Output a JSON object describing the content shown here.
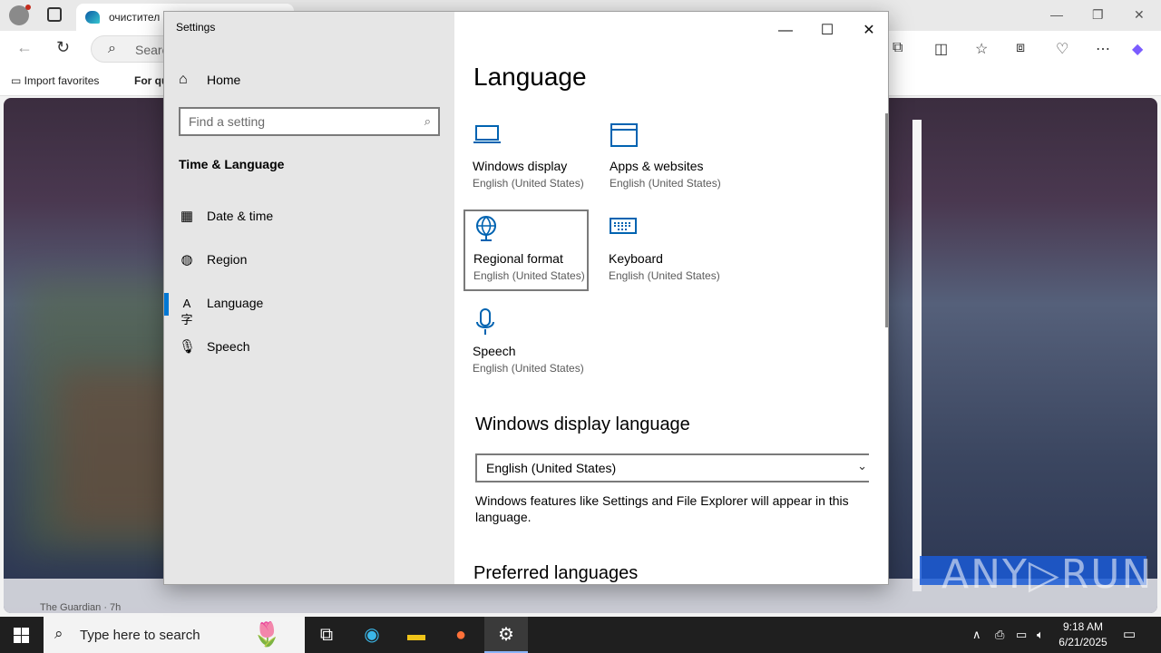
{
  "browser": {
    "tab_title": "очистител",
    "address_placeholder": "Searc",
    "favorites": [
      "Import favorites",
      "For qu"
    ],
    "news_source": "The Guardian · 7h",
    "watermark": "ANY▷RUN"
  },
  "settings": {
    "window_title": "Settings",
    "home_label": "Home",
    "search_placeholder": "Find a setting",
    "section_title": "Time & Language",
    "nav": [
      {
        "label": "Date & time",
        "icon": "calendar-clock-icon"
      },
      {
        "label": "Region",
        "icon": "globe-icon"
      },
      {
        "label": "Language",
        "icon": "language-icon",
        "active": true
      },
      {
        "label": "Speech",
        "icon": "microphone-icon"
      }
    ],
    "page_title": "Language",
    "tiles": [
      {
        "name": "Windows display",
        "sub": "English (United States)",
        "icon": "laptop-icon"
      },
      {
        "name": "Apps & websites",
        "sub": "English (United States)",
        "icon": "window-icon"
      },
      {
        "name": "Regional format",
        "sub": "English (United States)",
        "icon": "regional-globe-icon",
        "selected": true
      },
      {
        "name": "Keyboard",
        "sub": "English (United States)",
        "icon": "keyboard-icon"
      },
      {
        "name": "Speech",
        "sub": "English (United States)",
        "icon": "microphone-icon"
      }
    ],
    "display_language_heading": "Windows display language",
    "display_language_value": "English (United States)",
    "display_language_desc": "Windows features like Settings and File Explorer will appear in this language.",
    "preferred_heading": "Preferred languages"
  },
  "taskbar": {
    "search_placeholder": "Type here to search",
    "time": "9:18 AM",
    "date": "6/21/2025"
  }
}
